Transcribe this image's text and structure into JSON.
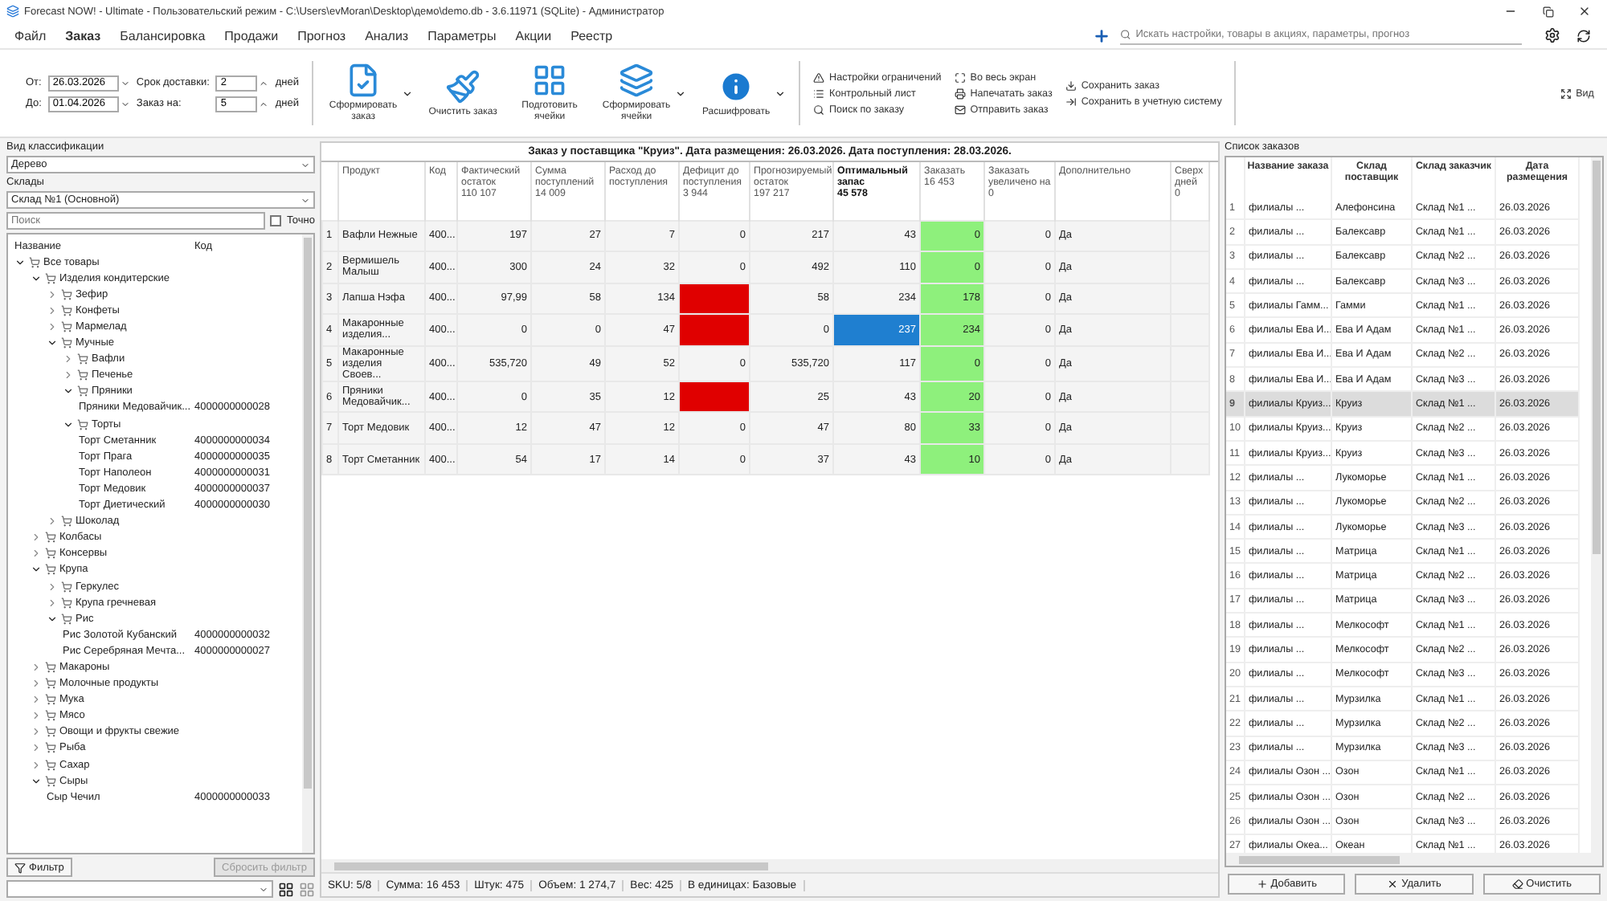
{
  "window": {
    "title": "Forecast NOW! - Ultimate - Пользовательский режим - C:\\Users\\evMoran\\Desktop\\демо\\demo.db - 3.6.11971 (SQLite) - Администратор"
  },
  "menu": [
    {
      "label": "Файл",
      "selected": false
    },
    {
      "label": "Заказ",
      "selected": true
    },
    {
      "label": "Балансировка",
      "selected": false
    },
    {
      "label": "Продажи",
      "selected": false
    },
    {
      "label": "Прогноз",
      "selected": false
    },
    {
      "label": "Анализ",
      "selected": false
    },
    {
      "label": "Параметры",
      "selected": false
    },
    {
      "label": "Акции",
      "selected": false
    },
    {
      "label": "Реестр",
      "selected": false
    }
  ],
  "global_search": {
    "placeholder": "Искать настройки, товары в акциях, параметры, прогноз"
  },
  "toolbar": {
    "from_label": "От:",
    "from": "26.03.2026",
    "to_label": "До:",
    "to": "01.04.2026",
    "delivery_label": "Срок доставки:",
    "delivery": "2",
    "order_for_label": "Заказ на:",
    "order_for": "5",
    "delivery_unit": "дней",
    "order_for_unit": "дней",
    "big_buttons": [
      {
        "label": "Сформировать заказ",
        "dropdown": true
      },
      {
        "label": "Очистить заказ",
        "dropdown": false
      },
      {
        "label": "Подготовить ячейки",
        "dropdown": false
      },
      {
        "label": "Сформировать ячейки",
        "dropdown": true
      },
      {
        "label": "Расшифровать",
        "dropdown": true
      }
    ],
    "small_buttons": [
      [
        "Настройки ограничений",
        "Контрольный лист",
        "Поиск по заказу"
      ],
      [
        "Во весь экран",
        "Напечатать заказ",
        "Отправить заказ"
      ],
      [
        "Сохранить заказ",
        "Сохранить в учетную систему"
      ]
    ],
    "view_button": "Вид"
  },
  "left": {
    "classification_label": "Вид классификации",
    "classification": "Дерево",
    "warehouses_label": "Склады",
    "warehouse": "Склад №1 (Основной)",
    "search": {
      "placeholder": "Поиск"
    },
    "exact": {
      "label": "Точно",
      "checked": false
    },
    "tree": {
      "columns": [
        "Название",
        "Код"
      ],
      "items": [
        {
          "label": "Все товары",
          "expanded": true,
          "children": [
            {
              "label": "Изделия кондитерские",
              "expanded": true,
              "children": [
                {
                  "label": "Зефир",
                  "expanded": false
                },
                {
                  "label": "Конфеты",
                  "expanded": false
                },
                {
                  "label": "Мармелад",
                  "expanded": false
                },
                {
                  "label": "Мучные",
                  "expanded": true,
                  "children": [
                    {
                      "label": "Вафли",
                      "expanded": false
                    },
                    {
                      "label": "Печенье",
                      "expanded": false
                    },
                    {
                      "label": "Пряники",
                      "expanded": true,
                      "children": [
                        {
                          "label": "Пряники Медовайчик...",
                          "code": "4000000000028"
                        }
                      ]
                    },
                    {
                      "label": "Торты",
                      "expanded": true,
                      "children": [
                        {
                          "label": "Торт Сметанник",
                          "code": "4000000000034"
                        },
                        {
                          "label": "Торт Прага",
                          "code": "4000000000035"
                        },
                        {
                          "label": "Торт Наполеон",
                          "code": "4000000000031"
                        },
                        {
                          "label": "Торт Медовик",
                          "code": "4000000000037"
                        },
                        {
                          "label": "Торт Диетический",
                          "code": "4000000000030"
                        }
                      ]
                    }
                  ]
                },
                {
                  "label": "Шоколад",
                  "expanded": false
                }
              ]
            },
            {
              "label": "Колбасы",
              "expanded": false
            },
            {
              "label": "Консервы",
              "expanded": false
            },
            {
              "label": "Крупа",
              "expanded": true,
              "children": [
                {
                  "label": "Геркулес",
                  "expanded": false
                },
                {
                  "label": "Крупа гречневая",
                  "expanded": false
                },
                {
                  "label": "Рис",
                  "expanded": true,
                  "children": [
                    {
                      "label": "Рис Золотой Кубанский",
                      "code": "4000000000032"
                    },
                    {
                      "label": "Рис Серебряная Мечта...",
                      "code": "4000000000027"
                    }
                  ]
                }
              ]
            },
            {
              "label": "Макароны",
              "expanded": false
            },
            {
              "label": "Молочные продукты",
              "expanded": false
            },
            {
              "label": "Мука",
              "expanded": false
            },
            {
              "label": "Мясо",
              "expanded": false
            },
            {
              "label": "Овощи и фрукты свежие",
              "expanded": false
            },
            {
              "label": "Рыба",
              "expanded": false
            },
            {
              "label": "Сахар",
              "expanded": false
            },
            {
              "label": "Сыры",
              "expanded": true,
              "children": [
                {
                  "label": "Сыр Чечил",
                  "code": "4000000000033"
                }
              ]
            }
          ]
        }
      ]
    },
    "filter_button": "Фильтр",
    "reset_filter_button": "Сбросить фильтр"
  },
  "order_table": {
    "title": "Заказ у поставщика \"Круиз\". Дата размещения: 26.03.2026. Дата поступления: 28.03.2026.",
    "columns": [
      {
        "label": "Продукт"
      },
      {
        "label": "Код"
      },
      {
        "label": "Фактический остаток",
        "sub": "110 107"
      },
      {
        "label": "Сумма поступлений",
        "sub": "14 009"
      },
      {
        "label": "Расход до поступления"
      },
      {
        "label": "Дефицит до поступления",
        "sub": "3 944"
      },
      {
        "label": "Прогнозируемый остаток",
        "sub": "197 217"
      },
      {
        "label": "Оптимальный запас",
        "sub": "45 578",
        "emphasis": true
      },
      {
        "label": "Заказать",
        "sub": "16 453",
        "highlighted": true
      },
      {
        "label": "Заказать увеличено на",
        "sub": "0"
      },
      {
        "label": "Дополнительно"
      },
      {
        "label": "Сверх дней",
        "sub": "0"
      }
    ],
    "rows": [
      {
        "n": "1",
        "cells": [
          "Вафли Нежные",
          "400...",
          "197",
          "27",
          "7",
          "0",
          "217",
          "43",
          "0",
          "0",
          "Да",
          ""
        ],
        "deficit_alert": false,
        "optimal_selected": false
      },
      {
        "n": "2",
        "cells": [
          "Вермишель Малыш",
          "400...",
          "300",
          "24",
          "32",
          "0",
          "492",
          "110",
          "0",
          "0",
          "Да",
          ""
        ],
        "deficit_alert": false,
        "optimal_selected": false
      },
      {
        "n": "3",
        "cells": [
          "Лапша Нэфа",
          "400...",
          "97,99",
          "58",
          "134",
          "",
          "58",
          "234",
          "178",
          "0",
          "Да",
          ""
        ],
        "deficit_alert": true,
        "optimal_selected": false
      },
      {
        "n": "4",
        "cells": [
          "Макаронные изделия...",
          "400...",
          "0",
          "0",
          "47",
          "",
          "0",
          "237",
          "234",
          "0",
          "Да",
          ""
        ],
        "deficit_alert": true,
        "optimal_selected": true
      },
      {
        "n": "5",
        "cells": [
          "Макаронные изделия Своев...",
          "400...",
          "535,720",
          "49",
          "52",
          "0",
          "535,720",
          "117",
          "0",
          "0",
          "Да",
          ""
        ],
        "deficit_alert": false,
        "optimal_selected": false
      },
      {
        "n": "6",
        "cells": [
          "Пряники Медовайчик...",
          "400...",
          "0",
          "35",
          "12",
          "",
          "25",
          "43",
          "20",
          "0",
          "Да",
          ""
        ],
        "deficit_alert": true,
        "optimal_selected": false
      },
      {
        "n": "7",
        "cells": [
          "Торт Медовик",
          "400...",
          "12",
          "47",
          "12",
          "0",
          "47",
          "80",
          "33",
          "0",
          "Да",
          ""
        ],
        "deficit_alert": false,
        "optimal_selected": false
      },
      {
        "n": "8",
        "cells": [
          "Торт Сметанник",
          "400...",
          "54",
          "17",
          "14",
          "0",
          "37",
          "43",
          "10",
          "0",
          "Да",
          ""
        ],
        "deficit_alert": false,
        "optimal_selected": false
      }
    ]
  },
  "status_bar": [
    "SKU: 5/8",
    "Сумма: 16 453",
    "Штук: 475",
    "Объем: 1 274,7",
    "Вес: 425",
    "В единицах: Базовые"
  ],
  "orders": {
    "label": "Список заказов",
    "columns": [
      "Название заказа",
      "Склад поставщик",
      "Склад заказчик",
      "Дата размещения"
    ],
    "rows": [
      {
        "n": "1",
        "cells": [
          "филиалы ...",
          "Алефонсина",
          "Склад №1 ...",
          "26.03.2026"
        ],
        "selected": false
      },
      {
        "n": "2",
        "cells": [
          "филиалы ...",
          "Балексавр",
          "Склад №1 ...",
          "26.03.2026"
        ],
        "selected": false
      },
      {
        "n": "3",
        "cells": [
          "филиалы ...",
          "Балексавр",
          "Склад №2 ...",
          "26.03.2026"
        ],
        "selected": false
      },
      {
        "n": "4",
        "cells": [
          "филиалы ...",
          "Балексавр",
          "Склад №3 ...",
          "26.03.2026"
        ],
        "selected": false
      },
      {
        "n": "5",
        "cells": [
          "филиалы Гамм...",
          "Гамми",
          "Склад №1 ...",
          "26.03.2026"
        ],
        "selected": false
      },
      {
        "n": "6",
        "cells": [
          "филиалы Ева И...",
          "Ева И Адам",
          "Склад №1 ...",
          "26.03.2026"
        ],
        "selected": false
      },
      {
        "n": "7",
        "cells": [
          "филиалы Ева И...",
          "Ева И Адам",
          "Склад №2 ...",
          "26.03.2026"
        ],
        "selected": false
      },
      {
        "n": "8",
        "cells": [
          "филиалы Ева И...",
          "Ева И Адам",
          "Склад №3 ...",
          "26.03.2026"
        ],
        "selected": false
      },
      {
        "n": "9",
        "cells": [
          "филиалы Круиз...",
          "Круиз",
          "Склад №1 ...",
          "26.03.2026"
        ],
        "selected": true
      },
      {
        "n": "10",
        "cells": [
          "филиалы Круиз...",
          "Круиз",
          "Склад №2 ...",
          "26.03.2026"
        ],
        "selected": false
      },
      {
        "n": "11",
        "cells": [
          "филиалы Круиз...",
          "Круиз",
          "Склад №3 ...",
          "26.03.2026"
        ],
        "selected": false
      },
      {
        "n": "12",
        "cells": [
          "филиалы ...",
          "Лукоморье",
          "Склад №1 ...",
          "26.03.2026"
        ],
        "selected": false
      },
      {
        "n": "13",
        "cells": [
          "филиалы ...",
          "Лукоморье",
          "Склад №2 ...",
          "26.03.2026"
        ],
        "selected": false
      },
      {
        "n": "14",
        "cells": [
          "филиалы ...",
          "Лукоморье",
          "Склад №3 ...",
          "26.03.2026"
        ],
        "selected": false
      },
      {
        "n": "15",
        "cells": [
          "филиалы ...",
          "Матрица",
          "Склад №1 ...",
          "26.03.2026"
        ],
        "selected": false
      },
      {
        "n": "16",
        "cells": [
          "филиалы ...",
          "Матрица",
          "Склад №2 ...",
          "26.03.2026"
        ],
        "selected": false
      },
      {
        "n": "17",
        "cells": [
          "филиалы ...",
          "Матрица",
          "Склад №3 ...",
          "26.03.2026"
        ],
        "selected": false
      },
      {
        "n": "18",
        "cells": [
          "филиалы ...",
          "Мелкософт",
          "Склад №1 ...",
          "26.03.2026"
        ],
        "selected": false
      },
      {
        "n": "19",
        "cells": [
          "филиалы ...",
          "Мелкософт",
          "Склад №2 ...",
          "26.03.2026"
        ],
        "selected": false
      },
      {
        "n": "20",
        "cells": [
          "филиалы ...",
          "Мелкософт",
          "Склад №3 ...",
          "26.03.2026"
        ],
        "selected": false
      },
      {
        "n": "21",
        "cells": [
          "филиалы ...",
          "Мурзилка",
          "Склад №1 ...",
          "26.03.2026"
        ],
        "selected": false
      },
      {
        "n": "22",
        "cells": [
          "филиалы ...",
          "Мурзилка",
          "Склад №2 ...",
          "26.03.2026"
        ],
        "selected": false
      },
      {
        "n": "23",
        "cells": [
          "филиалы ...",
          "Мурзилка",
          "Склад №3 ...",
          "26.03.2026"
        ],
        "selected": false
      },
      {
        "n": "24",
        "cells": [
          "филиалы Озон ...",
          "Озон",
          "Склад №1 ...",
          "26.03.2026"
        ],
        "selected": false
      },
      {
        "n": "25",
        "cells": [
          "филиалы Озон ...",
          "Озон",
          "Склад №2 ...",
          "26.03.2026"
        ],
        "selected": false
      },
      {
        "n": "26",
        "cells": [
          "филиалы Озон ...",
          "Озон",
          "Склад №3 ...",
          "26.03.2026"
        ],
        "selected": false
      },
      {
        "n": "27",
        "cells": [
          "филиалы Океа...",
          "Океан",
          "Склад №1 ...",
          "26.03.2026"
        ],
        "selected": false
      }
    ],
    "buttons": [
      "Добавить",
      "Удалить",
      "Очистить"
    ]
  }
}
